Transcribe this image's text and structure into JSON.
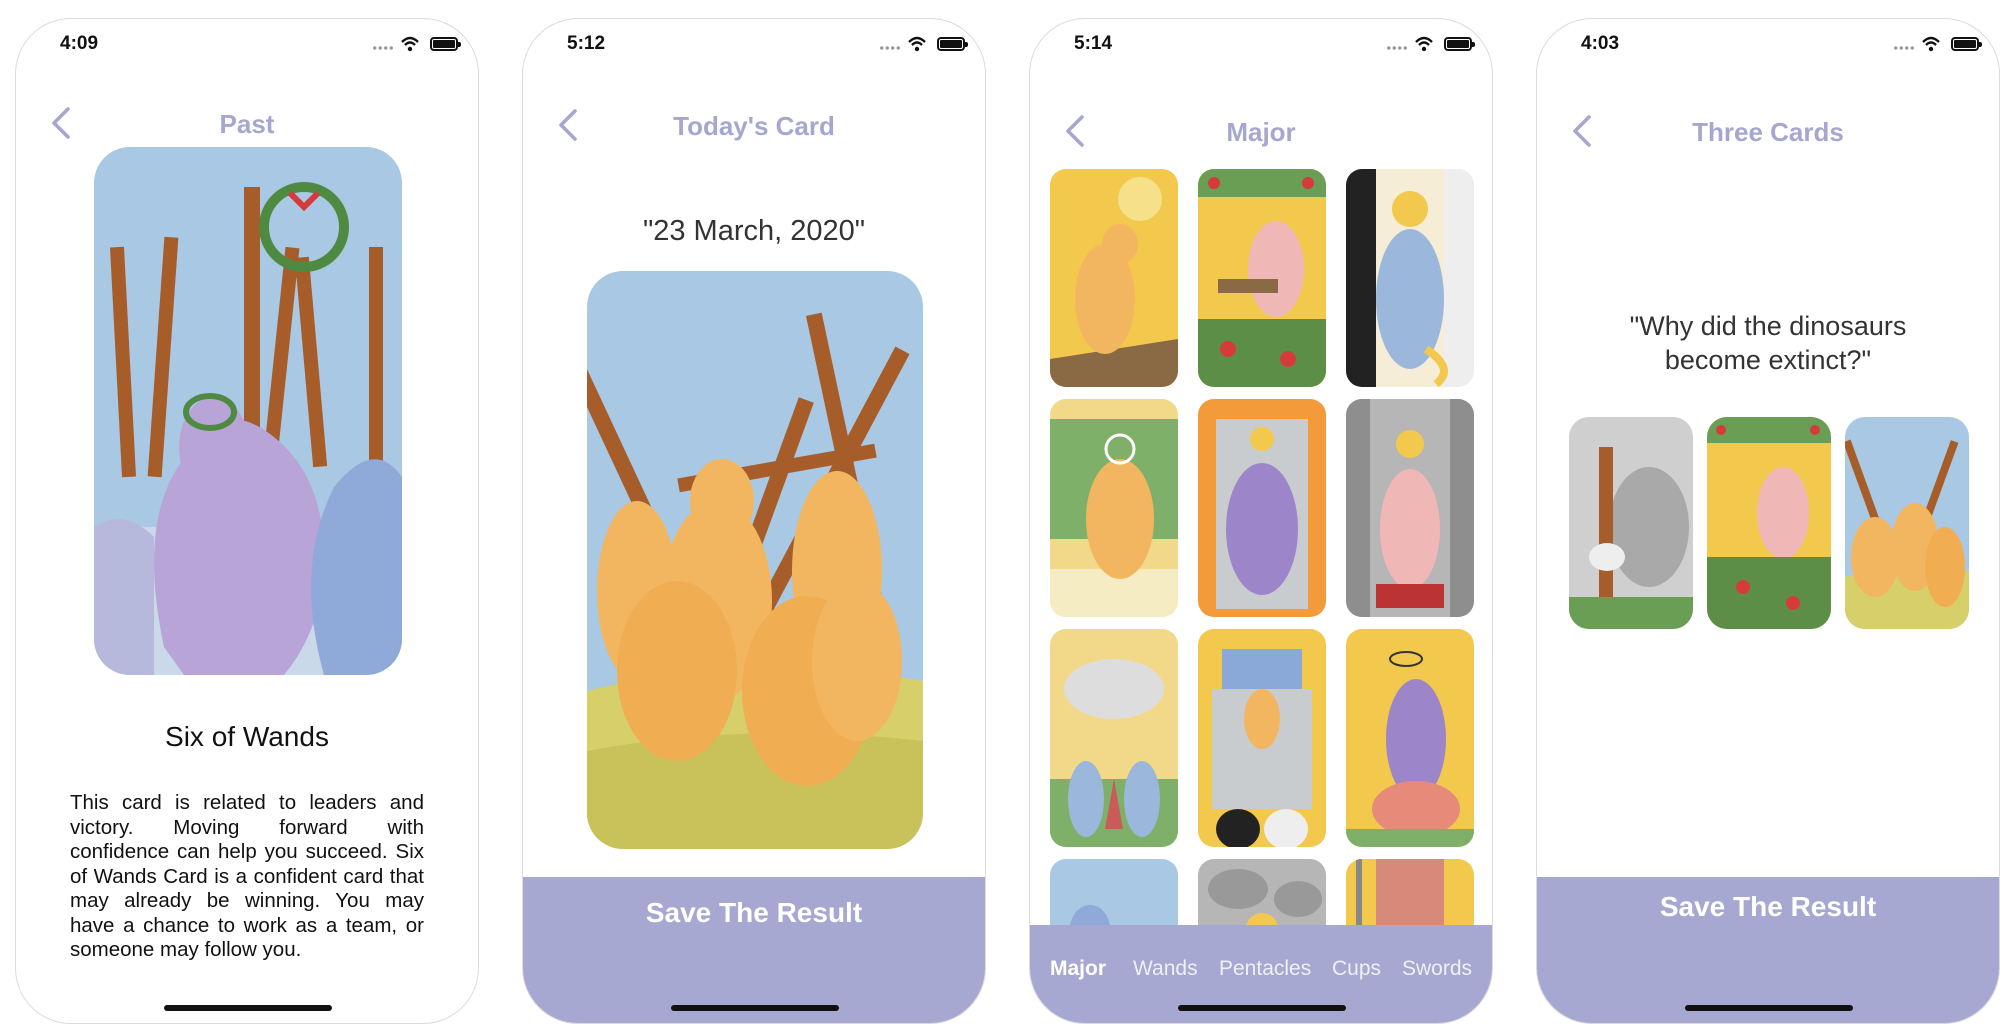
{
  "screens": [
    {
      "time": "4:09",
      "title": "Past",
      "card_name": "Six of Wands",
      "description": "This card is related to leaders and victory. Moving forward with confidence can help you succeed. Six of Wands Card is a confident card that may already be winning. You may have a chance to work as a team, or someone may follow you."
    },
    {
      "time": "5:12",
      "title": "Today's Card",
      "date": "\"23 March, 2020\"",
      "save_label": "Save The Result"
    },
    {
      "time": "5:14",
      "title": "Major",
      "tabs": [
        "Major",
        "Wands",
        "Pentacles",
        "Cups",
        "Swords"
      ],
      "active_tab": "Major"
    },
    {
      "time": "4:03",
      "title": "Three Cards",
      "question": "\"Why did the dinosaurs become extinct?\"",
      "save_label": "Save The Result"
    }
  ],
  "colors": {
    "accent": "#a6a8d1",
    "title": "#a6a7cf",
    "card_sky": "#a9c8e3",
    "card_yellow": "#f2c94c",
    "dino_orange": "#f3b660",
    "dino_purple": "#b9a4d8"
  }
}
